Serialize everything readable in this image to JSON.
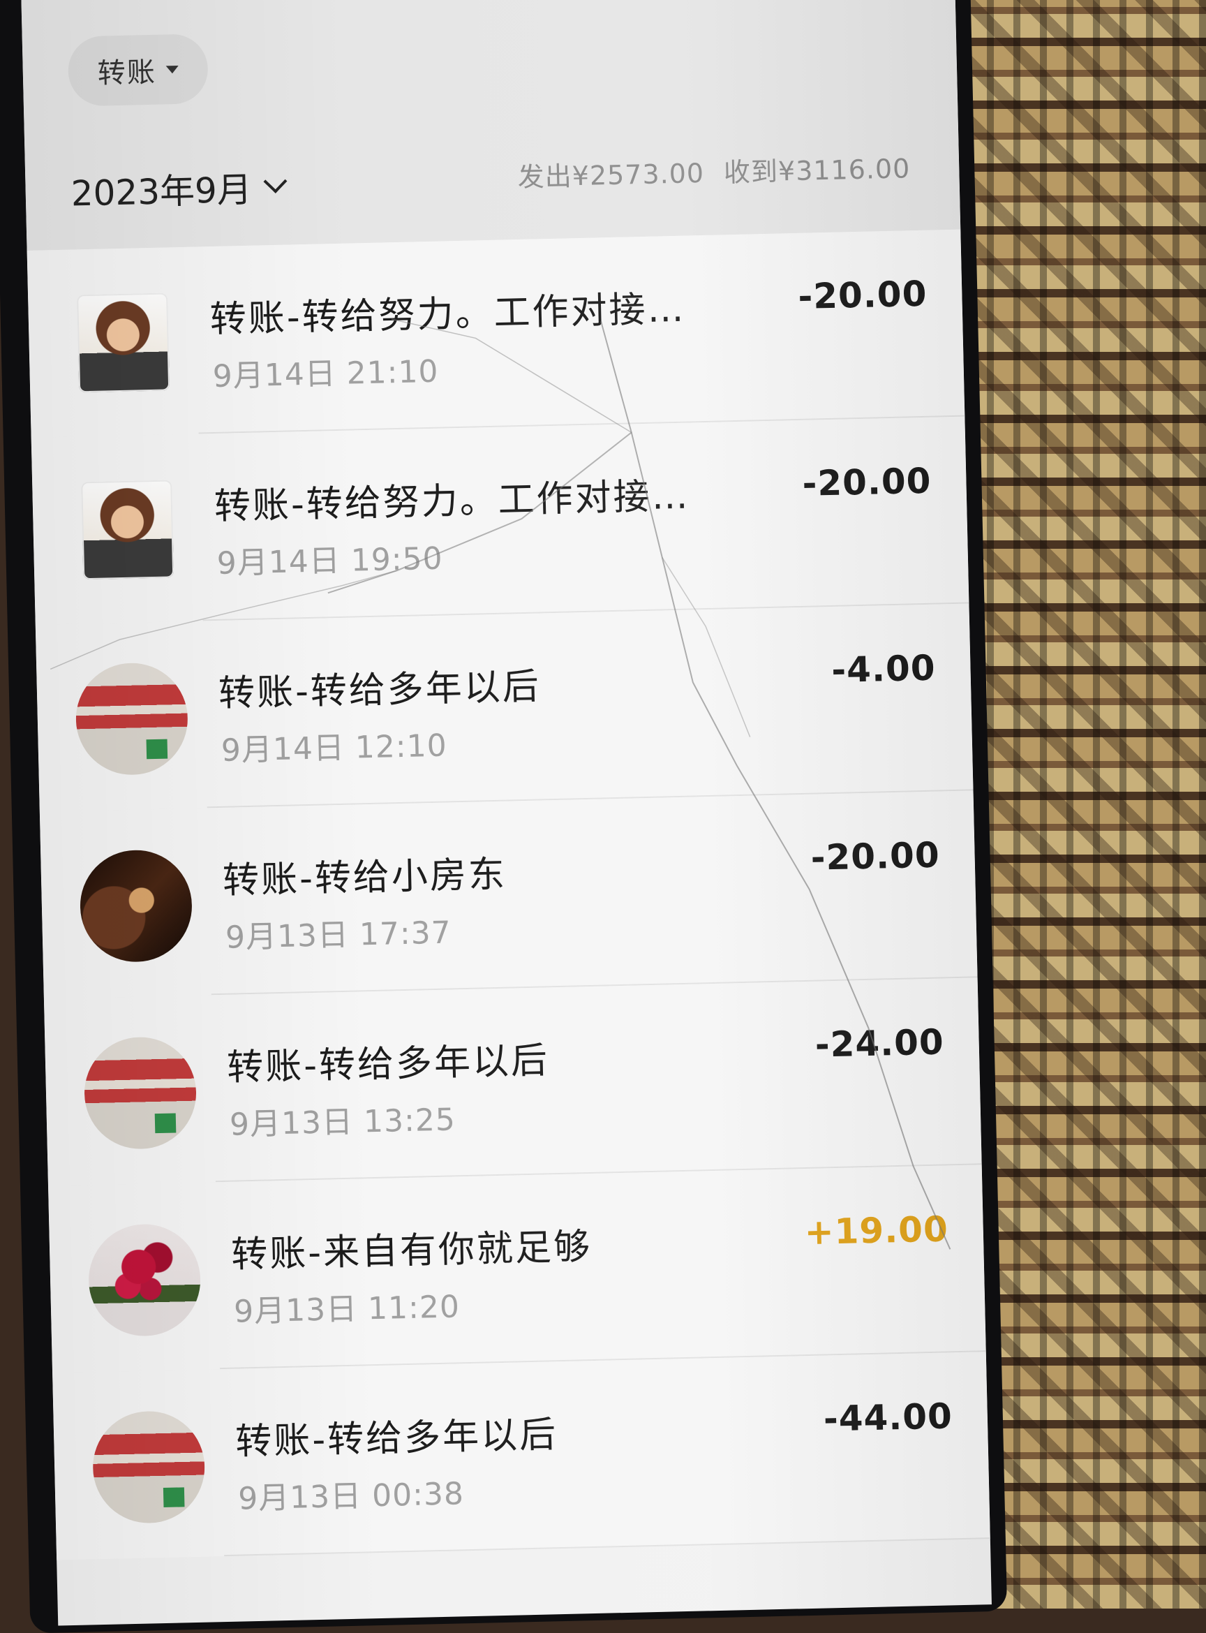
{
  "header": {
    "filter_label": "转账",
    "month_label": "2023年9月",
    "sent_summary": "发出¥2573.00",
    "received_summary": "收到¥3116.00"
  },
  "transactions": [
    {
      "title": "转账-转给努力。工作对接…",
      "time": "9月14日 21:10",
      "amount": "-20.00",
      "type": "out",
      "avatar": "cartoon-girl-avatar"
    },
    {
      "title": "转账-转给努力。工作对接…",
      "time": "9月14日 19:50",
      "amount": "-20.00",
      "type": "out",
      "avatar": "cartoon-girl-avatar"
    },
    {
      "title": "转账-转给多年以后",
      "time": "9月14日 12:10",
      "amount": "-4.00",
      "type": "out",
      "avatar": "book-cover-avatar"
    },
    {
      "title": "转账-转给小房东",
      "time": "9月13日 17:37",
      "amount": "-20.00",
      "type": "out",
      "avatar": "dark-photo-avatar"
    },
    {
      "title": "转账-转给多年以后",
      "time": "9月13日 13:25",
      "amount": "-24.00",
      "type": "out",
      "avatar": "book-cover-avatar"
    },
    {
      "title": "转账-来自有你就足够",
      "time": "9月13日 11:20",
      "amount": "+19.00",
      "type": "in",
      "avatar": "red-flower-avatar"
    },
    {
      "title": "转账-转给多年以后",
      "time": "9月13日 00:38",
      "amount": "-44.00",
      "type": "out",
      "avatar": "book-cover-avatar"
    }
  ],
  "colors": {
    "income": "#e0a21a",
    "expense": "#1a1a1a",
    "secondary_text": "#a0a0a0"
  }
}
